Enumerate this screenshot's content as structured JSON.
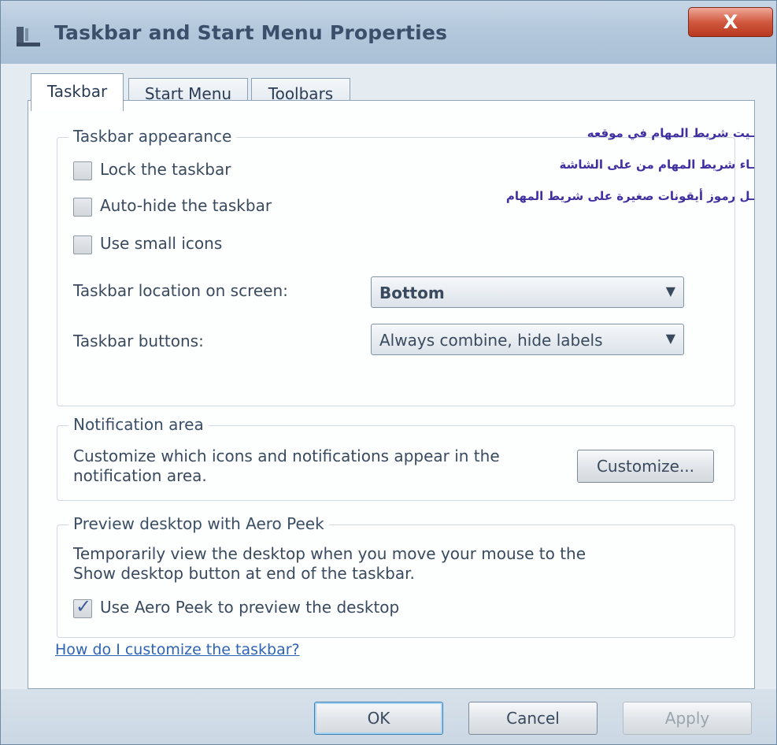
{
  "window": {
    "title": "Taskbar and Start Menu Properties",
    "close_label": "X"
  },
  "tabs": [
    {
      "label": "Taskbar",
      "active": true
    },
    {
      "label": "Start Menu",
      "active": false
    },
    {
      "label": "Toolbars",
      "active": false
    }
  ],
  "taskbar_appearance": {
    "title": "Taskbar appearance",
    "checkboxes": [
      {
        "label": "Lock the taskbar",
        "checked": false
      },
      {
        "label": "Auto-hide the taskbar",
        "checked": false
      },
      {
        "label": "Use small icons",
        "checked": false
      }
    ],
    "location_label": "Taskbar location on screen:",
    "location_value": "Bottom",
    "buttons_label": "Taskbar buttons:",
    "buttons_value": "Always combine, hide labels"
  },
  "annotations": [
    "ـيت شريط المهام في موقعه",
    "ـاء شريط المهام من على الشاشة",
    "ـل رموز أيقونات صغيرة على شريط المهام"
  ],
  "notification_area": {
    "title": "Notification area",
    "description_line1": "Customize which icons and notifications appear in the",
    "description_line2": "notification area.",
    "customize_label": "Customize..."
  },
  "aero_peek": {
    "title": "Preview desktop with Aero Peek",
    "description_line1": "Temporarily view the desktop when you move your mouse to the",
    "description_line2": "Show desktop button at end of the taskbar.",
    "checkbox_label": "Use Aero Peek to preview the desktop",
    "checked": true
  },
  "help_link": "How do I customize the taskbar?",
  "buttons": {
    "ok": "OK",
    "cancel": "Cancel",
    "apply": "Apply"
  },
  "colors": {
    "link": "#2f63b5",
    "annotation": "#3f2fa0",
    "close_button": "#c84a30"
  }
}
